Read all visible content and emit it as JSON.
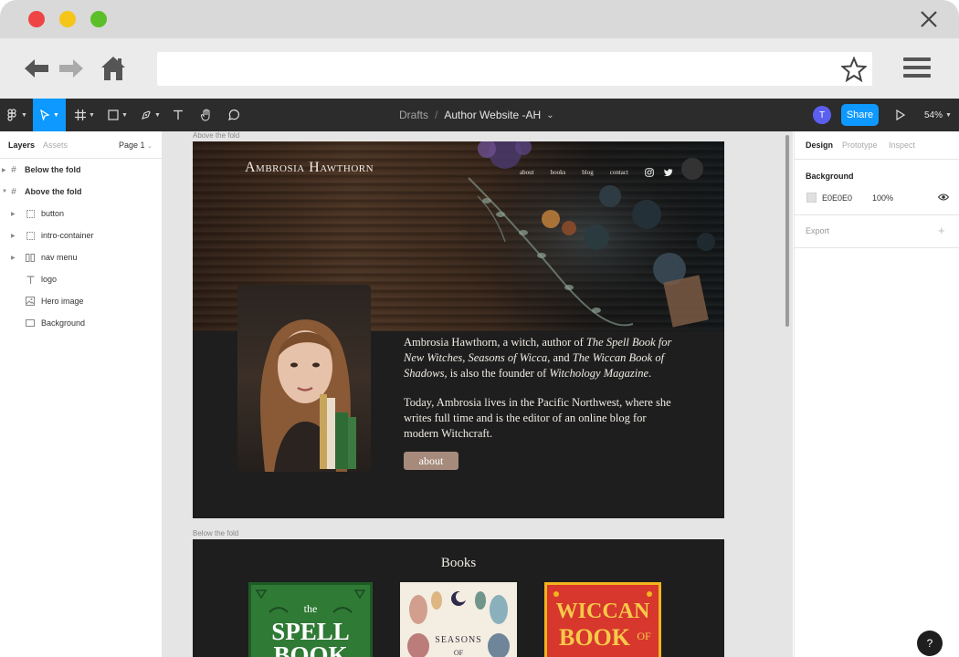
{
  "figma": {
    "breadcrumb": {
      "folder": "Drafts",
      "separator": "/",
      "file": "Author Website -AH",
      "file_caret": "⌄"
    },
    "avatar_initial": "T",
    "share_label": "Share",
    "zoom": "54%",
    "accent": "#0d99ff",
    "toolbar_bg": "#2c2c2c"
  },
  "left_panel": {
    "tabs": {
      "layers": "Layers",
      "assets": "Assets"
    },
    "page": "Page 1",
    "layers": [
      {
        "name": "Below the fold",
        "icon": "frame-icon"
      },
      {
        "name": "Above the fold",
        "icon": "frame-icon"
      },
      {
        "name": "button",
        "icon": "component-icon"
      },
      {
        "name": "intro-container",
        "icon": "component-icon"
      },
      {
        "name": "nav menu",
        "icon": "columns-icon"
      },
      {
        "name": "logo",
        "icon": "text-icon"
      },
      {
        "name": "Hero image",
        "icon": "image-icon"
      },
      {
        "name": "Background",
        "icon": "rectangle-icon"
      }
    ]
  },
  "canvas": {
    "frame1_label": "Above the fold",
    "frame2_label": "Below the fold",
    "site": {
      "logo": "Ambrosia Hawthorn",
      "nav": [
        "about",
        "books",
        "blog",
        "contact"
      ],
      "intro_p1_a": "Ambrosia Hawthorn, a witch, author of ",
      "intro_p1_b": "The Spell Book for New Witches, Seasons of Wicca,",
      "intro_p1_c": " and ",
      "intro_p1_d": "The Wiccan Book of Shadows,",
      "intro_p1_e": " is also the founder of ",
      "intro_p1_f": "Witchology Magazine",
      "intro_p1_g": ".",
      "intro_p2": "Today, Ambrosia lives in the Pacific Northwest, where she writes full time and is the editor of an online blog for modern Witchcraft.",
      "about_button": "about",
      "books_title": "Books",
      "book1_lines": [
        "the",
        "SPELL",
        "BOOK"
      ],
      "book2_lines": [
        "SEASONS",
        "OF"
      ],
      "book3_lines": [
        "WICCAN",
        "BOOK",
        "OF"
      ]
    }
  },
  "right_panel": {
    "tabs": {
      "design": "Design",
      "prototype": "Prototype",
      "inspect": "Inspect"
    },
    "background_heading": "Background",
    "bg_hex": "E0E0E0",
    "bg_opacity": "100%",
    "export_label": "Export",
    "export_add": "+"
  },
  "help_label": "?"
}
